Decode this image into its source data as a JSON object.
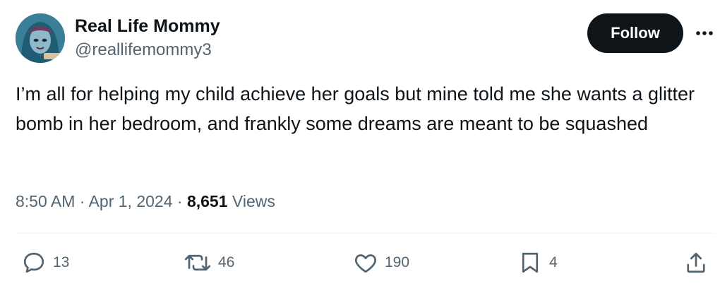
{
  "author": {
    "name": "Real Life Mommy",
    "handle": "@reallifemommy3"
  },
  "follow_label": "Follow",
  "tweet": {
    "text": "I’m all for helping my child achieve her goals but mine told me she wants a glitter bomb in her bedroom, and frankly some dreams are meant to be squashed"
  },
  "meta": {
    "time": "8:50 AM",
    "separator": "·",
    "date": "Apr 1, 2024",
    "views_count": "8,651",
    "views_label": "Views"
  },
  "actions": {
    "replies": "13",
    "reposts": "46",
    "likes": "190",
    "bookmarks": "4"
  },
  "icons": [
    "more-icon",
    "reply-icon",
    "repost-icon",
    "like-icon",
    "bookmark-icon",
    "share-icon"
  ]
}
